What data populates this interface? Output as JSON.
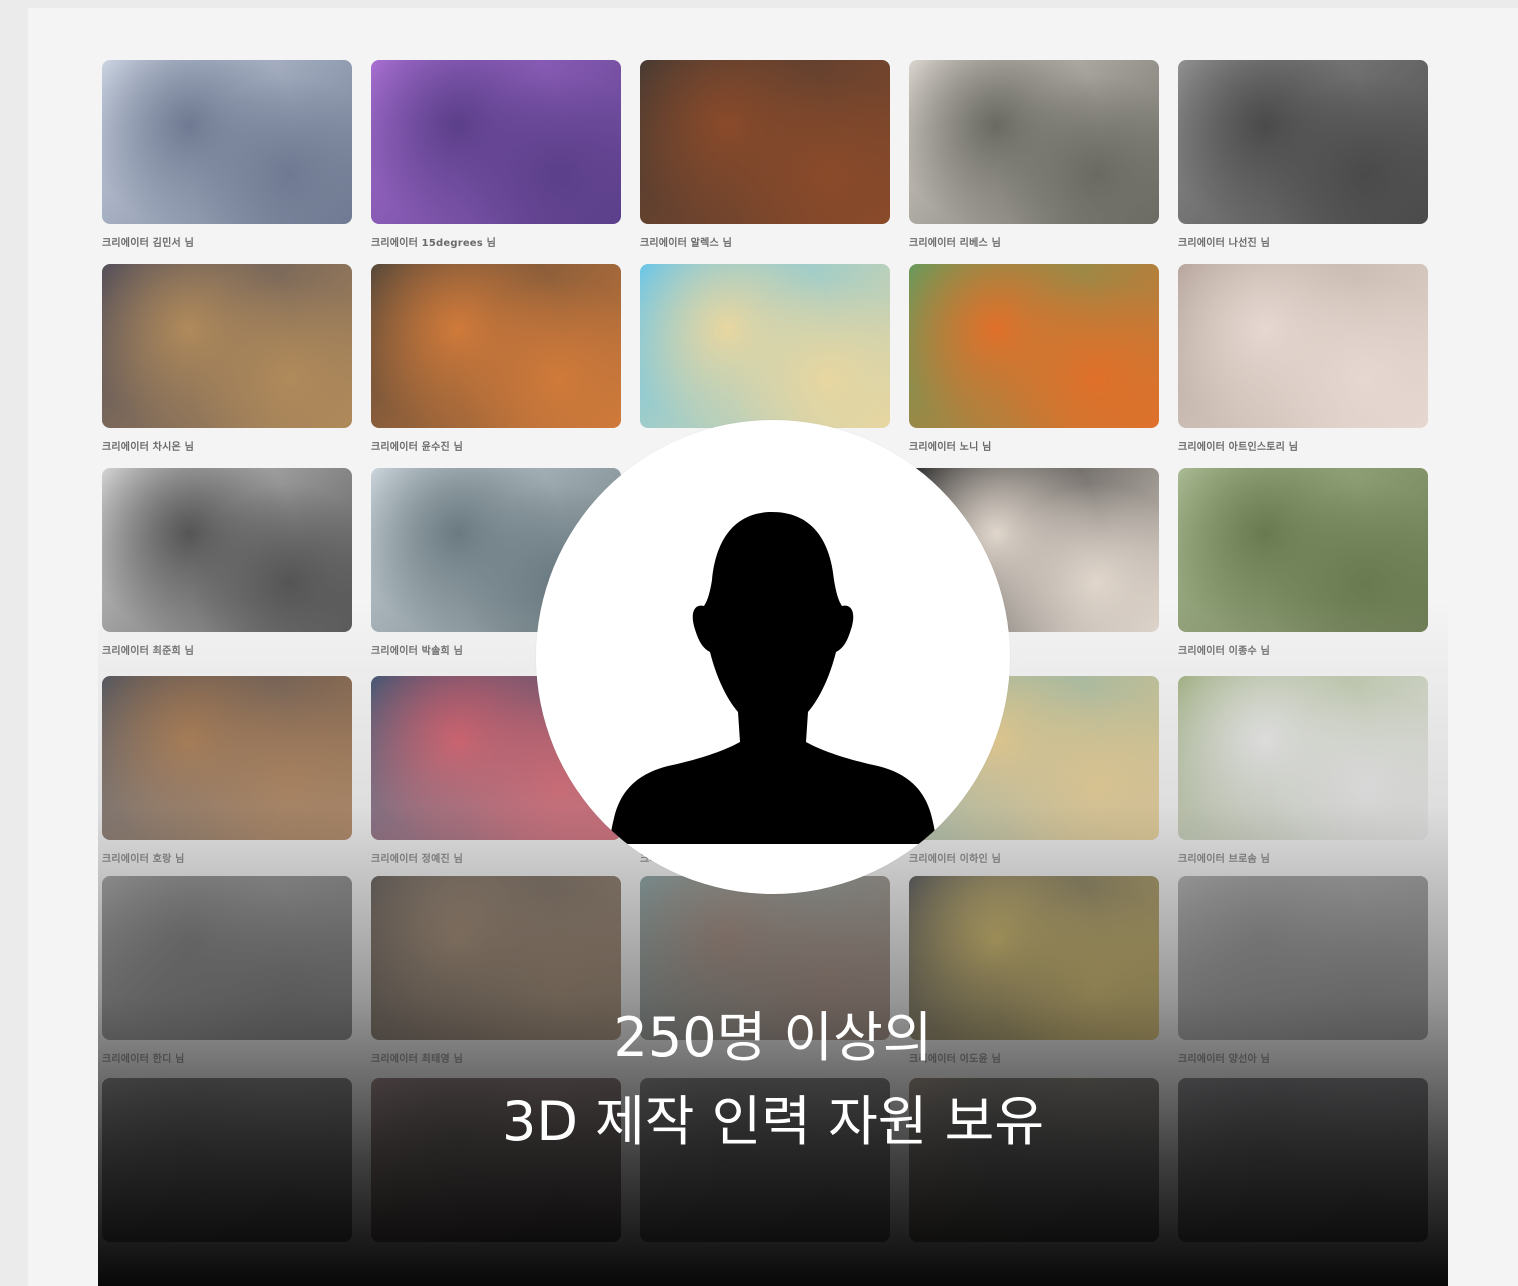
{
  "headline": {
    "line1": "250명 이상의",
    "line2": "3D 제작 인력 자원 보유"
  },
  "portfolio": {
    "rows": [
      [
        {
          "caption": "크리에이터 김민서 님",
          "colors": [
            "#c9d2e0",
            "#6f7a92"
          ]
        },
        {
          "caption": "크리에이터 15degrees 님",
          "colors": [
            "#a66ed0",
            "#5b3f8a"
          ]
        },
        {
          "caption": "크리에이터 알렉스 님",
          "colors": [
            "#4a3b32",
            "#8a4a2a"
          ]
        },
        {
          "caption": "크리에이터 리베스 님",
          "colors": [
            "#d8d2cc",
            "#6a6a62"
          ]
        },
        {
          "caption": "크리에이터 나선진 님",
          "colors": [
            "#8f8f8f",
            "#4a4a4a"
          ]
        }
      ],
      [
        {
          "caption": "크리에이터 차시온 님",
          "colors": [
            "#55505a",
            "#b08a5a"
          ]
        },
        {
          "caption": "크리에이터 윤수진 님",
          "colors": [
            "#5a4a3a",
            "#d07a3a"
          ]
        },
        {
          "caption": "",
          "colors": [
            "#6ec6e6",
            "#e8d6a0"
          ]
        },
        {
          "caption": "크리에이터 노니 님",
          "colors": [
            "#6a9a5a",
            "#e0702a"
          ]
        },
        {
          "caption": "크리에이터 아트인스토리 님",
          "colors": [
            "#b8a8a0",
            "#e6d8d0"
          ]
        }
      ],
      [
        {
          "caption": "크리에이터 최준희 님",
          "colors": [
            "#d0d0d0",
            "#555555"
          ]
        },
        {
          "caption": "크리에이터 박솔희 님",
          "colors": [
            "#c8d2d8",
            "#6a7a80"
          ]
        },
        {
          "caption": "",
          "colors": [
            "#999999",
            "#777777"
          ]
        },
        {
          "caption": "",
          "colors": [
            "#2a2a2a",
            "#e0d6cc"
          ]
        },
        {
          "caption": "크리에이터 이종수 님",
          "colors": [
            "#a8b890",
            "#6a7a50"
          ]
        }
      ],
      [
        {
          "caption": "크리에이터 호랑 님",
          "colors": [
            "#4a4a52",
            "#a06a3a"
          ]
        },
        {
          "caption": "크리에이터 정예진 님",
          "colors": [
            "#3a4a6a",
            "#d04a5a"
          ]
        },
        {
          "caption": "크리에이",
          "colors": [
            "#888888",
            "#666666"
          ]
        },
        {
          "caption": "크리에이터 이하인 님",
          "colors": [
            "#7ab0b0",
            "#e8c880"
          ]
        },
        {
          "caption": "크리에이터 브로솜 님",
          "colors": [
            "#a0b080",
            "#e8e8e8"
          ]
        }
      ],
      [
        {
          "caption": "크리에이터 한디 님",
          "colors": [
            "#8a8a8a",
            "#5a5a5a"
          ]
        },
        {
          "caption": "크리에이터 최태영 님",
          "colors": [
            "#3a302a",
            "#8a6a4a"
          ]
        },
        {
          "caption": "",
          "colors": [
            "#6a8a8a",
            "#8a6a5a"
          ]
        },
        {
          "caption": "크리에이터 이도윤 님",
          "colors": [
            "#2a2a2a",
            "#d0b040"
          ]
        },
        {
          "caption": "크리에이터 양선아 님",
          "colors": [
            "#9a9a9a",
            "#7a7a7a"
          ]
        }
      ],
      [
        {
          "caption": "",
          "colors": [
            "#5a5a5a",
            "#3a3a3a"
          ]
        },
        {
          "caption": "",
          "colors": [
            "#6a4a4a",
            "#3a2a2a"
          ]
        },
        {
          "caption": "",
          "colors": [
            "#5a5a5a",
            "#3a3a3a"
          ]
        },
        {
          "caption": "",
          "colors": [
            "#6a5a4a",
            "#3a3a3a"
          ]
        },
        {
          "caption": "",
          "colors": [
            "#5a5a60",
            "#3a3a40"
          ]
        }
      ]
    ]
  },
  "avatar": {
    "icon": "user-silhouette-icon",
    "background": "#ffffff",
    "fill": "#000000"
  }
}
